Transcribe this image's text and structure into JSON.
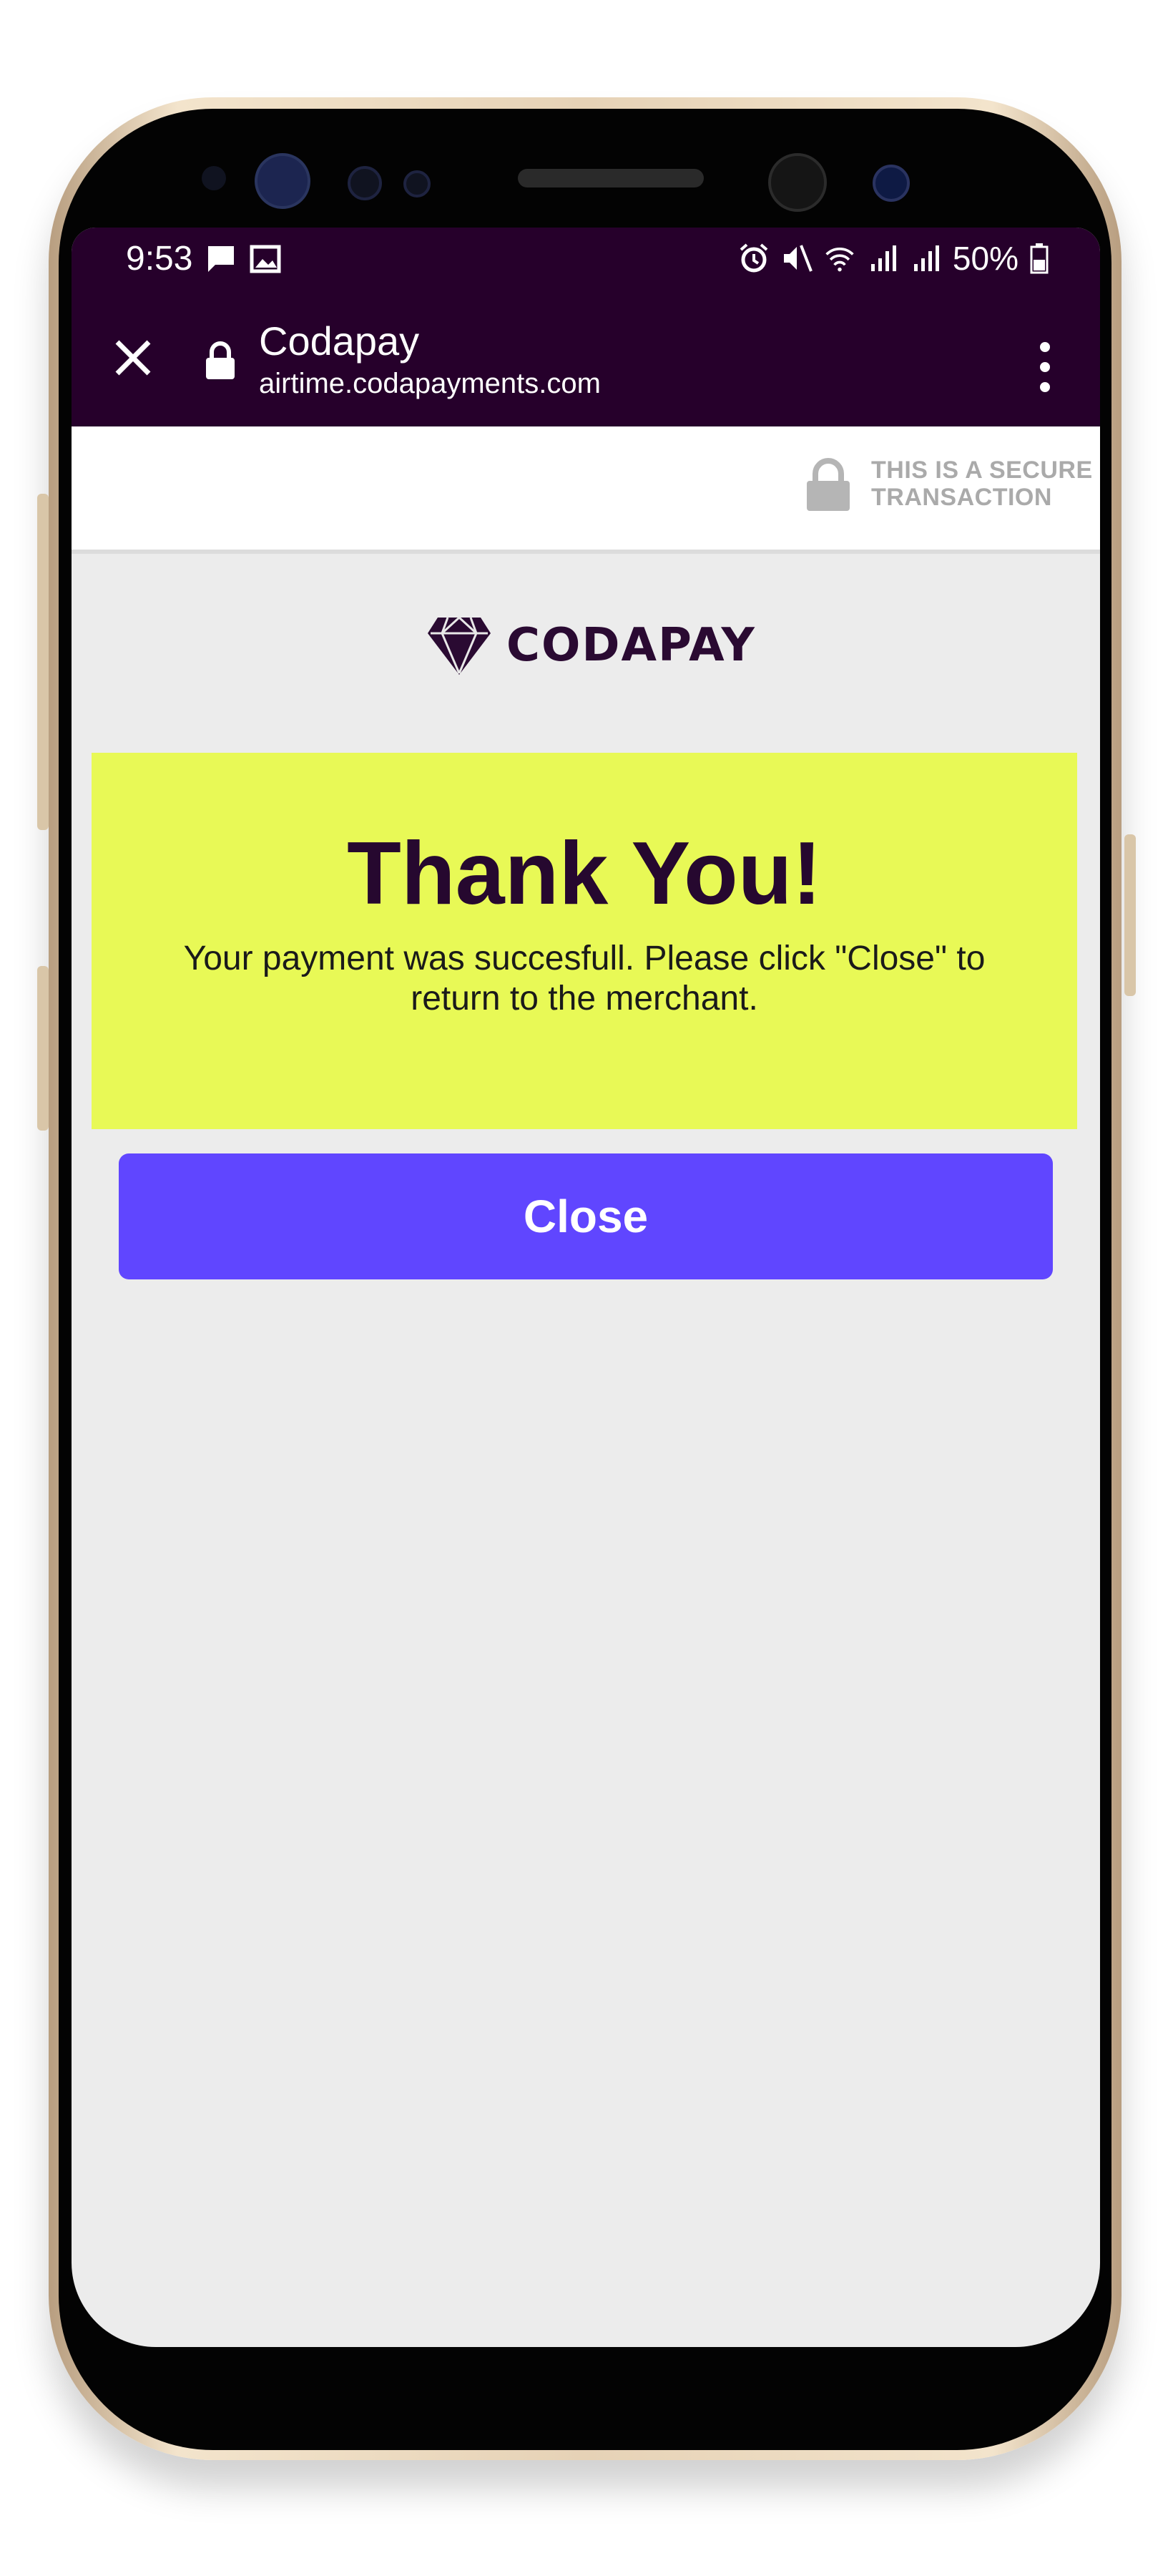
{
  "status_bar": {
    "time": "9:53",
    "battery": "50%",
    "icons": [
      "message-icon",
      "image-icon",
      "alarm-icon",
      "mute-icon",
      "wifi-icon",
      "signal-icon",
      "signal-icon",
      "battery-icon"
    ]
  },
  "browser": {
    "title": "Codapay",
    "url": "airtime.codapayments.com",
    "icons": [
      "close-icon",
      "lock-icon",
      "more-vert-icon"
    ]
  },
  "secure": {
    "line1": "THIS IS A SECURE",
    "line2": "TRANSACTION",
    "icon": "lock-icon"
  },
  "logo": {
    "text": "CODAPAY",
    "icon": "diamond-icon"
  },
  "banner": {
    "heading": "Thank You!",
    "message": "Your payment was succesfull. Please click \"Close\" to return to the merchant."
  },
  "actions": {
    "close_label": "Close"
  },
  "colors": {
    "browser_bar": "#26002b",
    "banner": "#e8f956",
    "button": "#6046ff",
    "heading": "#26082f",
    "page_bg": "#ececec"
  }
}
